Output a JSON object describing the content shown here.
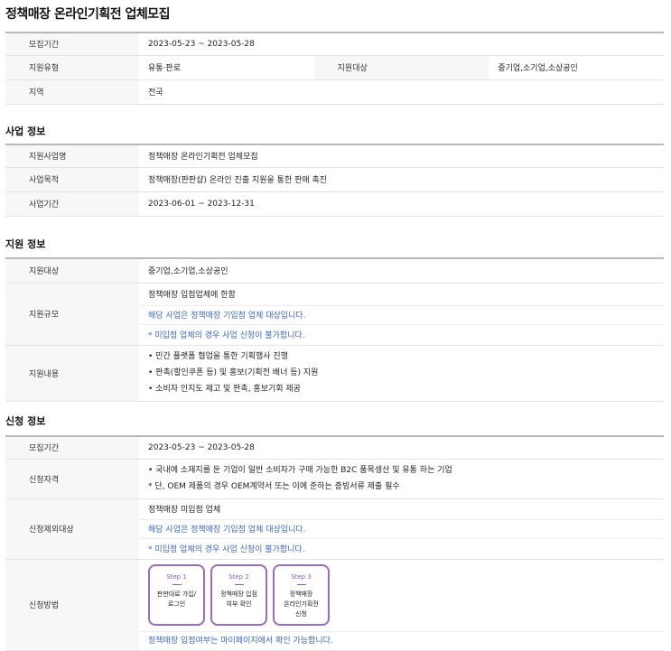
{
  "page_title": "정책매장 온라인기획전 업체모집",
  "basic": {
    "period_label": "모집기간",
    "period_value": "2023-05-23 ~ 2023-05-28",
    "type_label": "지원유형",
    "type_value": "유통·판로",
    "target_label": "지원대상",
    "target_value": "중기업,소기업,소상공인",
    "region_label": "지역",
    "region_value": "전국"
  },
  "business": {
    "heading": "사업 정보",
    "name_label": "지원사업명",
    "name_value": "정책매장 온라인기획전 업체모집",
    "purpose_label": "사업목적",
    "purpose_value": "정책매장(판판샵) 온라인 진출 지원을 통한 판매 촉진",
    "period_label": "사업기간",
    "period_value": "2023-06-01 ~ 2023-12-31"
  },
  "support": {
    "heading": "지원 정보",
    "target_label": "지원대상",
    "target_value": "중기업,소기업,소상공인",
    "scale_label": "지원규모",
    "scale_lines": [
      "정책매장 입점업체에 한함",
      "해당 사업은 정책매장 기입점 업체 대상입니다.",
      "* 미입점 업체의 경우 사업 신청이 불가합니다."
    ],
    "content_label": "지원내용",
    "content_lines": [
      "• 민간 플랫폼 협업을 통한 기획행사 진행",
      "• 판촉(할인쿠폰 등) 및 홍보(기획전 배너 등) 지원",
      "• 소비자 인지도 제고 및 판촉, 홍보기회 제공"
    ]
  },
  "apply": {
    "heading": "신청 정보",
    "period_label": "모집기간",
    "period_value": "2023-05-23 ~ 2023-05-28",
    "qual_label": "신청자격",
    "qual_lines": [
      "• 국내에 소재지를 둔 기업이 일반 소비자가 구매 가능한 B2C 품목생산 및 유통 하는 기업",
      "* 단, OEM 제품의 경우 OEM계약서 또는 이에 준하는 증빙서류 제출 필수"
    ],
    "excl_label": "신청제외대상",
    "excl_lines": [
      "정책매장 미입점 업체",
      "해당 사업은 정책매장 기입점 업체 대상입니다.",
      "* 미입점 업체의 경우 사업 신청이 불가합니다."
    ],
    "method_label": "신청방법",
    "steps": [
      {
        "label": "Step 1",
        "text1": "판판대로 가입/",
        "text2": "로그인",
        "text3": ""
      },
      {
        "label": "Step 2",
        "text1": "정책매장 입점",
        "text2": "여부 확인",
        "text3": ""
      },
      {
        "label": "Step 3",
        "text1": "정책매장",
        "text2": "온라인기획전",
        "text3": "신청"
      }
    ],
    "method_note": "정책매장 입점여부는 마이페이지에서 확인 가능합니다."
  },
  "colors": {
    "accent_blue": "#3a67c9",
    "step_border": "#9b6bc8"
  }
}
